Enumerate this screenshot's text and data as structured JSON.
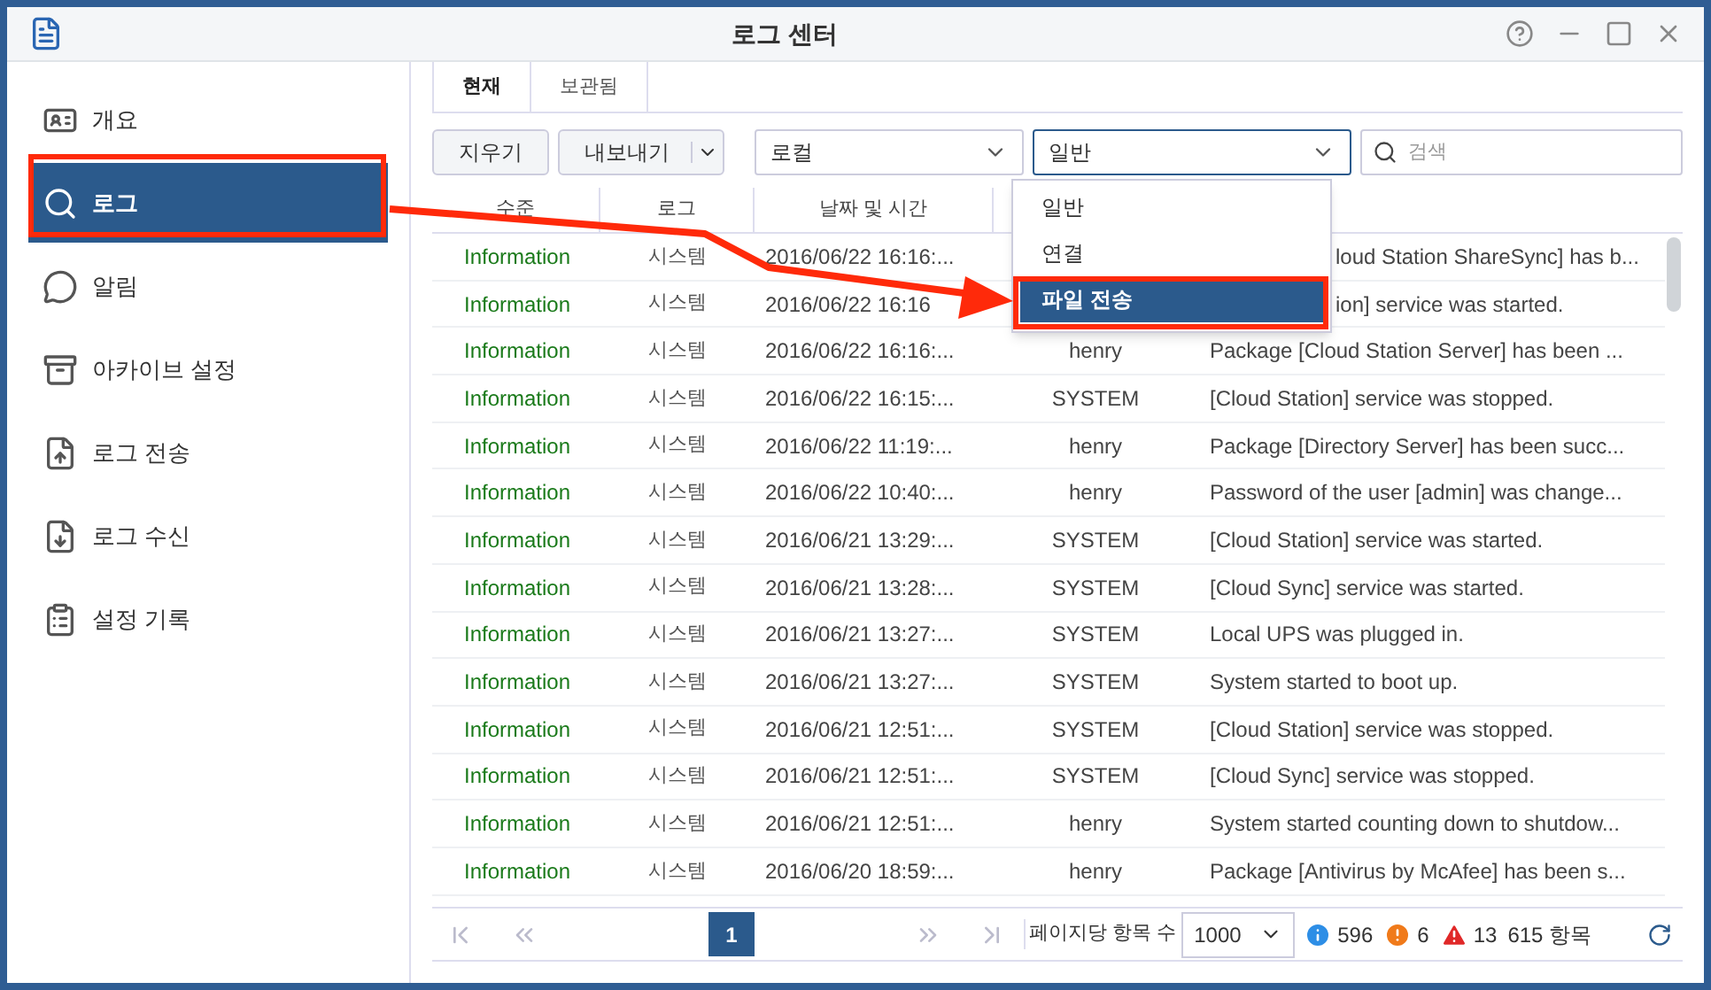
{
  "window": {
    "title": "로그 센터"
  },
  "sidebar": {
    "items": [
      {
        "label": "개요",
        "selected": false
      },
      {
        "label": "로그",
        "selected": true
      },
      {
        "label": "알림",
        "selected": false
      },
      {
        "label": "아카이브 설정",
        "selected": false
      },
      {
        "label": "로그 전송",
        "selected": false
      },
      {
        "label": "로그 수신",
        "selected": false
      },
      {
        "label": "설정 기록",
        "selected": false
      }
    ]
  },
  "tabs": [
    {
      "label": "현재",
      "selected": true
    },
    {
      "label": "보관됨",
      "selected": false
    }
  ],
  "toolbar": {
    "clear_button": "지우기",
    "export_button": "내보내기",
    "source_select": "로컬",
    "type_select": "일반",
    "search": {
      "placeholder": "검색"
    }
  },
  "type_menu": {
    "items": [
      {
        "label": "일반",
        "selected": false
      },
      {
        "label": "연결",
        "selected": false
      },
      {
        "label": "파일 전송",
        "selected": true
      }
    ]
  },
  "table": {
    "columns": [
      "수준",
      "로그",
      "날짜 및 시간"
    ],
    "rows": [
      {
        "level": "Information",
        "log": "시스템",
        "time": "2016/06/22 16:16:...",
        "message": "loud Station ShareSync] has b..."
      },
      {
        "level": "Information",
        "log": "시스템",
        "time": "2016/06/22 16:16",
        "message": "ion] service was started."
      },
      {
        "level": "Information",
        "log": "시스템",
        "time": "2016/06/22 16:16:...",
        "user": "henry",
        "message": "Package [Cloud Station Server] has been ..."
      },
      {
        "level": "Information",
        "log": "시스템",
        "time": "2016/06/22 16:15:...",
        "user": "SYSTEM",
        "message": "[Cloud Station] service was stopped."
      },
      {
        "level": "Information",
        "log": "시스템",
        "time": "2016/06/22 11:19:...",
        "user": "henry",
        "message": "Package [Directory Server] has been succ..."
      },
      {
        "level": "Information",
        "log": "시스템",
        "time": "2016/06/22 10:40:...",
        "user": "henry",
        "message": "Password of the user [admin] was change..."
      },
      {
        "level": "Information",
        "log": "시스템",
        "time": "2016/06/21 13:29:...",
        "user": "SYSTEM",
        "message": "[Cloud Station] service was started."
      },
      {
        "level": "Information",
        "log": "시스템",
        "time": "2016/06/21 13:28:...",
        "user": "SYSTEM",
        "message": "[Cloud Sync] service was started."
      },
      {
        "level": "Information",
        "log": "시스템",
        "time": "2016/06/21 13:27:...",
        "user": "SYSTEM",
        "message": "Local UPS was plugged in."
      },
      {
        "level": "Information",
        "log": "시스템",
        "time": "2016/06/21 13:27:...",
        "user": "SYSTEM",
        "message": "System started to boot up."
      },
      {
        "level": "Information",
        "log": "시스템",
        "time": "2016/06/21 12:51:...",
        "user": "SYSTEM",
        "message": "[Cloud Station] service was stopped."
      },
      {
        "level": "Information",
        "log": "시스템",
        "time": "2016/06/21 12:51:...",
        "user": "SYSTEM",
        "message": "[Cloud Sync] service was stopped."
      },
      {
        "level": "Information",
        "log": "시스템",
        "time": "2016/06/21 12:51:...",
        "user": "henry",
        "message": "System started counting down to shutdow..."
      },
      {
        "level": "Information",
        "log": "시스템",
        "time": "2016/06/20 18:59:...",
        "user": "henry",
        "message": "Package [Antivirus by McAfee] has been s..."
      }
    ]
  },
  "footer": {
    "pages": [
      {
        "label": "1",
        "selected": true
      }
    ],
    "per_page_label": "페이지당 항목 수",
    "per_page": "1000",
    "info_count": "596",
    "warning_count": "6",
    "error_count": "13",
    "total": "615 항목"
  }
}
